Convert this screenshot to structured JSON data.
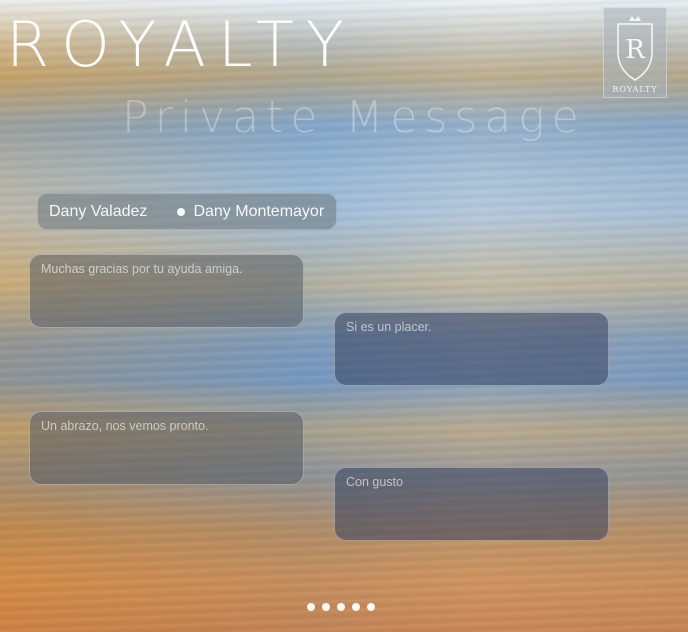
{
  "header": {
    "brand": "ROYALTY",
    "subtitle": "Private Message",
    "logo_letter": "R",
    "logo_text": "ROYALTY"
  },
  "participants": {
    "first": "Dany Valadez",
    "second": "Dany Montemayor"
  },
  "messages": [
    {
      "side": "left",
      "text": "Muchas gracias por tu ayuda amiga."
    },
    {
      "side": "right",
      "text": "Si es un placer."
    },
    {
      "side": "left",
      "text": "Un abrazo, nos vemos pronto."
    },
    {
      "side": "right",
      "text": "Con gusto"
    }
  ],
  "pager": {
    "pages": 5
  }
}
